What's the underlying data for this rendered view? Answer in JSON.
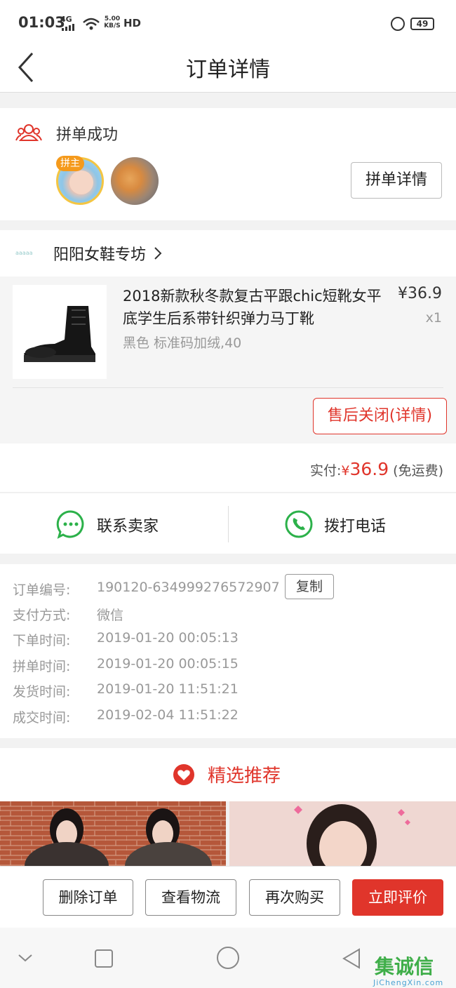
{
  "status_bar": {
    "time": "01:03",
    "network": "4G",
    "speed": "5.00 KB/S",
    "hd": "HD",
    "battery": "49"
  },
  "header": {
    "title": "订单详情"
  },
  "group_buy": {
    "status": "拼单成功",
    "leader_badge": "拼主",
    "detail_button": "拼单详情"
  },
  "store": {
    "name": "阳阳女鞋专坊",
    "logo_text": "aaaaa"
  },
  "product": {
    "name": "2018新款秋冬款复古平跟chic短靴女平底学生后系带针织弹力马丁靴",
    "price": "¥36.9",
    "quantity": "x1",
    "sku": "黑色 标准码加绒,40",
    "after_sale_button": "售后关闭(详情)"
  },
  "total": {
    "label": "实付:",
    "currency": "¥",
    "amount": "36.9",
    "note": "(免运费)"
  },
  "contact": {
    "seller": "联系卖家",
    "phone": "拨打电话"
  },
  "order_info": [
    {
      "key": "订单编号:",
      "value": "190120-634999276572907"
    },
    {
      "key": "支付方式:",
      "value": "微信"
    },
    {
      "key": "下单时间:",
      "value": "2019-01-20 00:05:13"
    },
    {
      "key": "拼单时间:",
      "value": "2019-01-20 00:05:15"
    },
    {
      "key": "发货时间:",
      "value": "2019-01-20 11:51:21"
    },
    {
      "key": "成交时间:",
      "value": "2019-02-04 11:51:22"
    }
  ],
  "copy_button": "复制",
  "recommend": {
    "title": "精选推荐"
  },
  "bottom_actions": {
    "delete": "删除订单",
    "logistics": "查看物流",
    "rebuy": "再次购买",
    "review": "立即评价"
  },
  "watermark": {
    "brand": "集诚信",
    "url": "JiChengXin.com"
  },
  "colors": {
    "accent_red": "#e0352b",
    "wechat_green": "#2cb14a",
    "badge_orange": "#f59a1b"
  }
}
